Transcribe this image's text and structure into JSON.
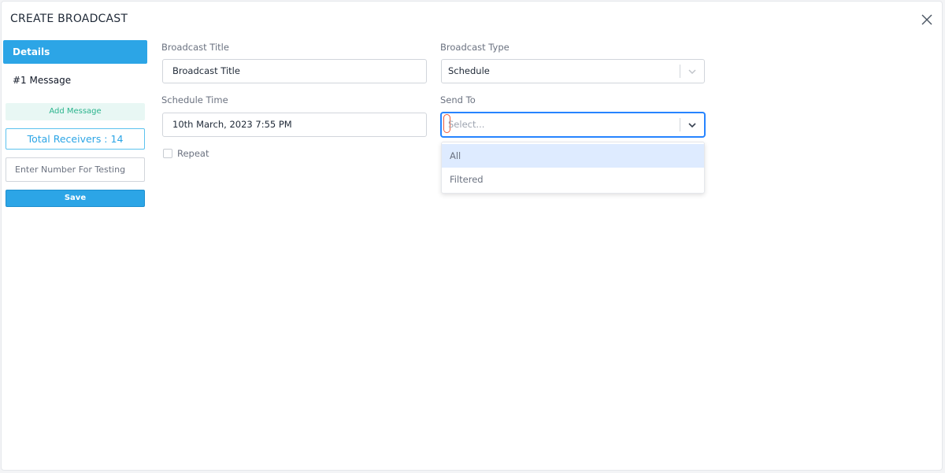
{
  "modal": {
    "title": "CREATE BROADCAST"
  },
  "sidebar": {
    "details_label": "Details",
    "message_label": "#1 Message",
    "add_message_label": "Add Message",
    "total_receivers": "Total Receivers : 14",
    "test_number_placeholder": "Enter Number For Testing",
    "save_label": "Save"
  },
  "form": {
    "broadcast_title": {
      "label": "Broadcast Title",
      "value": "Broadcast Title"
    },
    "broadcast_type": {
      "label": "Broadcast Type",
      "value": "Schedule"
    },
    "schedule_time": {
      "label": "Schedule Time",
      "value": "10th March, 2023 7:55 PM"
    },
    "send_to": {
      "label": "Send To",
      "placeholder": "Select...",
      "options": [
        "All",
        "Filtered"
      ],
      "highlighted_option": "All"
    },
    "repeat": {
      "label": "Repeat",
      "checked": false
    }
  },
  "colors": {
    "primary": "#2ca5e6",
    "add_message_bg": "#e8f7f4",
    "add_message_text": "#2bb48d",
    "focus_border": "#2684ff",
    "option_highlight": "#deebff"
  },
  "icons": {
    "close": "close-icon",
    "dropdown": "chevron-down-icon"
  }
}
